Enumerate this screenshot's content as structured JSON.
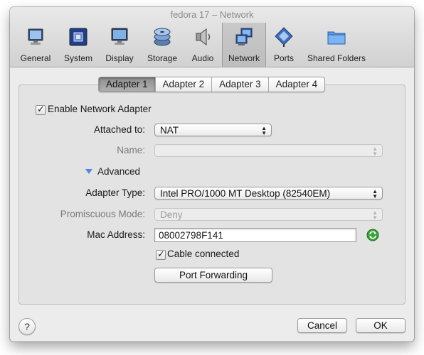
{
  "window": {
    "title": "fedora 17 – Network"
  },
  "toolbar": {
    "items": [
      {
        "label": "General"
      },
      {
        "label": "System"
      },
      {
        "label": "Display"
      },
      {
        "label": "Storage"
      },
      {
        "label": "Audio"
      },
      {
        "label": "Network"
      },
      {
        "label": "Ports"
      },
      {
        "label": "Shared Folders"
      }
    ],
    "active": "Network"
  },
  "tabs": [
    "Adapter 1",
    "Adapter 2",
    "Adapter 3",
    "Adapter 4"
  ],
  "selected_tab": "Adapter 1",
  "form": {
    "enable_label": "Enable Network Adapter",
    "attached_label": "Attached to:",
    "attached_value": "NAT",
    "name_label": "Name:",
    "name_value": "",
    "advanced_label": "Advanced",
    "adapter_type_label": "Adapter Type:",
    "adapter_type_value": "Intel PRO/1000 MT Desktop (82540EM)",
    "promiscuous_label": "Promiscuous Mode:",
    "promiscuous_value": "Deny",
    "mac_label": "Mac Address:",
    "mac_value": "08002798F141",
    "cable_label": "Cable connected",
    "port_forwarding_label": "Port Forwarding"
  },
  "footer": {
    "help_label": "?",
    "cancel_label": "Cancel",
    "ok_label": "OK"
  },
  "colors": {
    "accent_blue": "#4a8ad8",
    "refresh_green": "#3aa33a"
  }
}
